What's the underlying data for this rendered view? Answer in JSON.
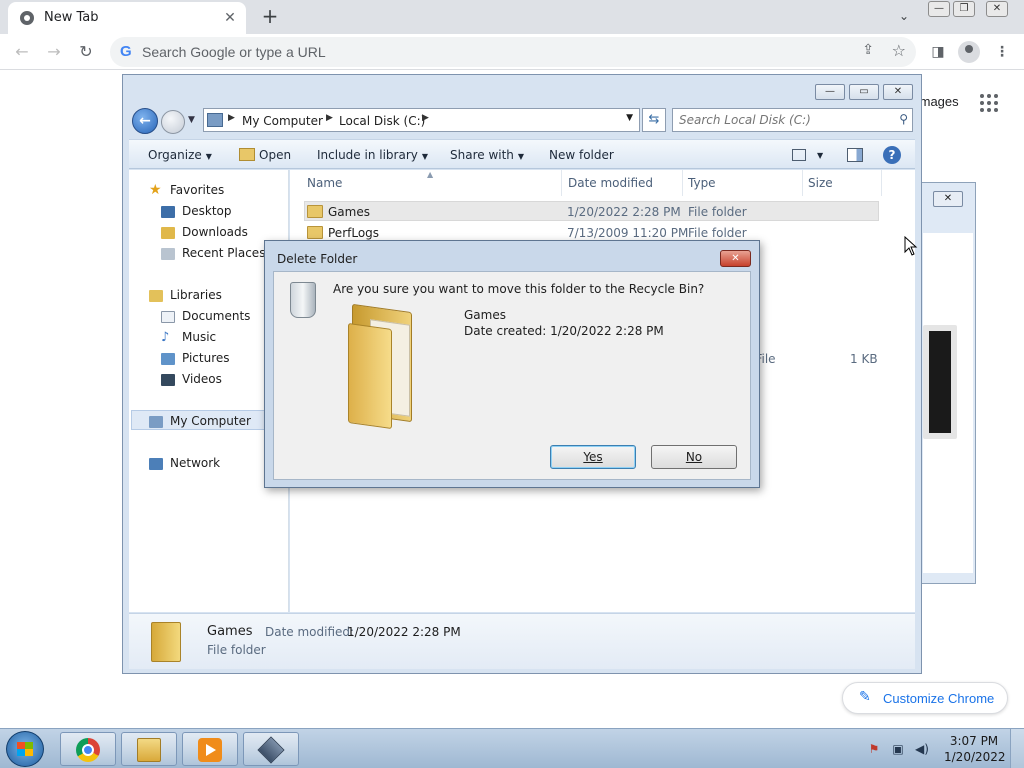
{
  "browser": {
    "tab_title": "New Tab",
    "tab_close_icon": "close-icon",
    "new_tab_icon": "plus-icon",
    "omnibox_placeholder": "Search Google or type a URL",
    "images_link": "Images",
    "customize_chrome": "Customize Chrome"
  },
  "explorer": {
    "breadcrumbs": [
      "My Computer",
      "Local Disk (C:)"
    ],
    "search_placeholder": "Search Local Disk (C:)",
    "commands": {
      "organize": "Organize",
      "open": "Open",
      "include_in_library": "Include in library",
      "share_with": "Share with",
      "new_folder": "New folder"
    },
    "nav": {
      "favorites": "Favorites",
      "desktop": "Desktop",
      "downloads": "Downloads",
      "recent_places": "Recent Places",
      "libraries": "Libraries",
      "documents": "Documents",
      "music": "Music",
      "pictures": "Pictures",
      "videos": "Videos",
      "my_computer": "My Computer",
      "network": "Network"
    },
    "columns": {
      "name": "Name",
      "date_modified": "Date modified",
      "type": "Type",
      "size": "Size"
    },
    "rows": [
      {
        "name": "Games",
        "date": "1/20/2022 2:28 PM",
        "type": "File folder",
        "size": ""
      },
      {
        "name": "PerfLogs",
        "date": "7/13/2009 11:20 PM",
        "type": "File folder",
        "size": ""
      }
    ],
    "partial_row": {
      "type": "...ch File",
      "size": "1 KB"
    },
    "details": {
      "name": "Games",
      "date_label": "Date modified:",
      "date_value": "1/20/2022 2:28 PM",
      "type": "File folder"
    }
  },
  "dialog": {
    "title": "Delete Folder",
    "question": "Are you sure you want to move this folder to the Recycle Bin?",
    "folder_name": "Games",
    "date_created": "Date created: 1/20/2022 2:28 PM",
    "yes": "Yes",
    "no": "No"
  },
  "taskbar": {
    "time": "3:07 PM",
    "date": "1/20/2022"
  }
}
